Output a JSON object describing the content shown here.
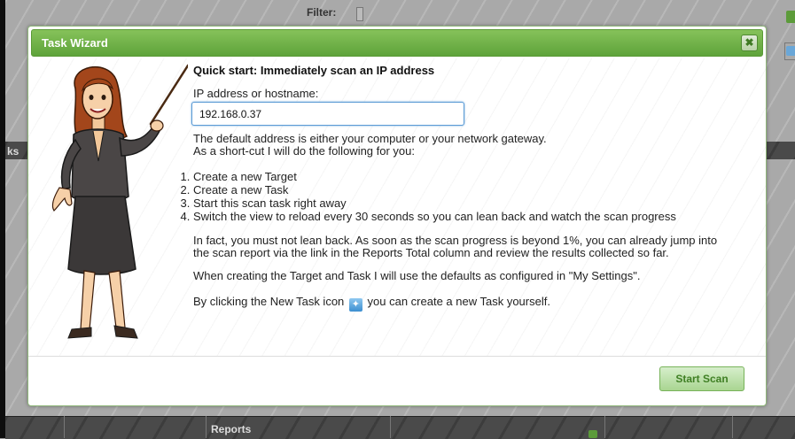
{
  "background": {
    "filter_label": "Filter:",
    "partial_tab_label": "ks",
    "bottom_column_label": "Reports"
  },
  "dialog": {
    "title": "Task Wizard",
    "close_icon": "close-icon",
    "heading": "Quick start: Immediately scan an IP address",
    "ip_label": "IP address or hostname:",
    "ip_value": "192.168.0.37",
    "default_note": "The default address is either your computer or your network gateway.",
    "shortcut_note": "As a short-cut I will do the following for you:",
    "steps": [
      "Create a new Target",
      "Create a new Task",
      "Start this scan task right away",
      "Switch the view to reload every 30 seconds so you can lean back and watch the scan progress"
    ],
    "lean_back_line1": "In fact, you must not lean back. As soon as the scan progress is beyond 1%, you can already jump into",
    "lean_back_line2": "the scan report via the link in the Reports Total column and review the results collected so far.",
    "defaults_note": "When creating the Target and Task I will use the defaults as configured in \"My Settings\".",
    "new_task_prefix": "By clicking the New Task icon",
    "new_task_suffix": "you can create a new Task yourself.",
    "new_task_icon": "new-task-icon",
    "start_button": "Start Scan",
    "accent_color": "#6aaf45"
  }
}
